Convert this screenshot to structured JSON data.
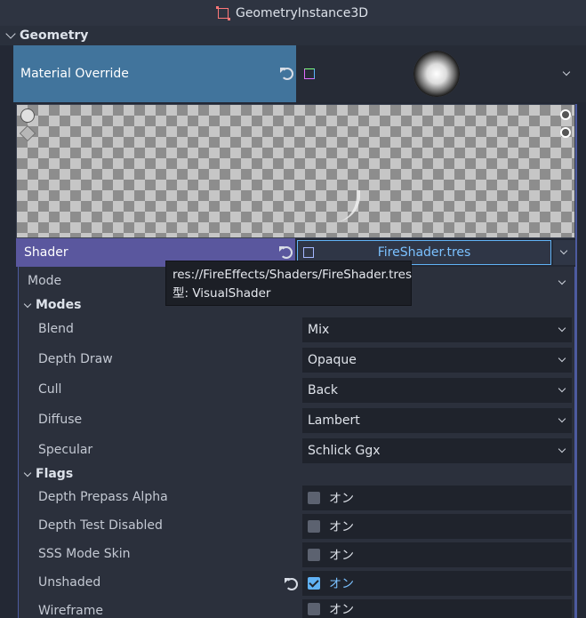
{
  "header": {
    "node_name": "GeometryInstance3D",
    "node_icon": "node3d-icon"
  },
  "section": {
    "title": "Geometry"
  },
  "material_override": {
    "label": "Material Override",
    "resource_icon": "resource-icon",
    "preview": "fire-material-thumbnail"
  },
  "shader": {
    "label": "Shader",
    "value": "FireShader.tres"
  },
  "tooltip": {
    "path": "res://FireEffects/Shaders/FireShader.tres",
    "type_line": "型: VisualShader"
  },
  "mode": {
    "label": "Mode"
  },
  "modes": {
    "title": "Modes",
    "items": [
      {
        "label": "Blend",
        "value": "Mix"
      },
      {
        "label": "Depth Draw",
        "value": "Opaque"
      },
      {
        "label": "Cull",
        "value": "Back"
      },
      {
        "label": "Diffuse",
        "value": "Lambert"
      },
      {
        "label": "Specular",
        "value": "Schlick Ggx"
      }
    ]
  },
  "flags": {
    "title": "Flags",
    "items": [
      {
        "label": "Depth Prepass Alpha",
        "value": "オン",
        "checked": false
      },
      {
        "label": "Depth Test Disabled",
        "value": "オン",
        "checked": false
      },
      {
        "label": "SSS Mode Skin",
        "value": "オン",
        "checked": false
      },
      {
        "label": "Unshaded",
        "value": "オン",
        "checked": true
      },
      {
        "label": "Wireframe",
        "value": "オン",
        "checked": false
      }
    ]
  },
  "colors": {
    "accent": "#60b2f5",
    "material_label_bg": "#41749c",
    "shader_label_bg": "#5a579e"
  }
}
